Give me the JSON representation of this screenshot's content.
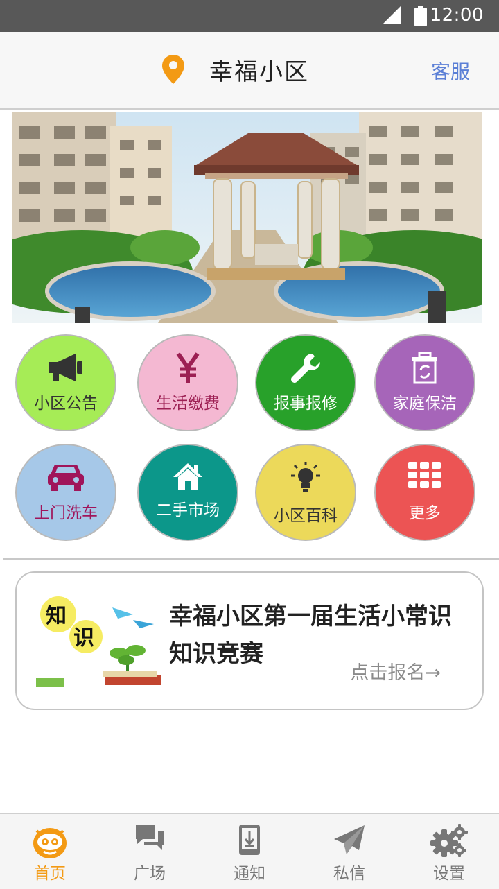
{
  "status_bar": {
    "time": "12:00"
  },
  "header": {
    "location_icon": "map-pin-icon",
    "title": "幸福小区",
    "service_label": "客服",
    "accent": "#f39a14"
  },
  "banner": {
    "image": "residential-community-pavilion-pool-photo"
  },
  "services": [
    {
      "label": "小区公告",
      "icon": "megaphone-icon",
      "bg": "#a6ec56",
      "fg": "#333333"
    },
    {
      "label": "生活缴费",
      "icon": "yen-icon",
      "bg": "#f4b8d2",
      "fg": "#9c1f53"
    },
    {
      "label": "报事报修",
      "icon": "wrench-icon",
      "bg": "#28a12a",
      "fg": "#ffffff"
    },
    {
      "label": "家庭保洁",
      "icon": "recycle-bin-icon",
      "bg": "#a665b9",
      "fg": "#ffffff"
    },
    {
      "label": "上门洗车",
      "icon": "car-icon",
      "bg": "#a6c8e8",
      "fg": "#a0155a"
    },
    {
      "label": "二手市场",
      "icon": "house-icon",
      "bg": "#0c978a",
      "fg": "#ffffff"
    },
    {
      "label": "小区百科",
      "icon": "lightbulb-icon",
      "bg": "#ecd95a",
      "fg": "#333333"
    },
    {
      "label": "更多",
      "icon": "grid-icon",
      "bg": "#ec5454",
      "fg": "#ffffff"
    }
  ],
  "promo": {
    "image_text": [
      "知",
      "识"
    ],
    "title": "幸福小区第一届生活小常识知识竞赛",
    "cta": "点击报名→"
  },
  "tabs": [
    {
      "label": "首页",
      "icon": "mascot-icon",
      "active": true
    },
    {
      "label": "广场",
      "icon": "chat-bubbles-icon",
      "active": false
    },
    {
      "label": "通知",
      "icon": "phone-download-icon",
      "active": false
    },
    {
      "label": "私信",
      "icon": "paper-plane-icon",
      "active": false
    },
    {
      "label": "设置",
      "icon": "gears-icon",
      "active": false
    }
  ]
}
